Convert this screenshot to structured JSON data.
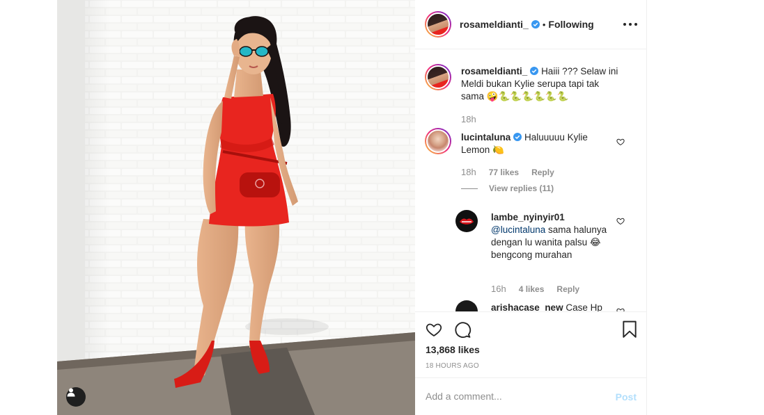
{
  "post": {
    "author": "rosameldianti_",
    "follow_status": "Following",
    "separator": "•",
    "caption": {
      "user": "rosameldianti_",
      "text": "Haiii ??? Selaw ini Meldi bukan Kylie serupa tapi tak sama 🤪🐍🐍🐍🐍🐍🐍",
      "time": "18h"
    },
    "comments": [
      {
        "user": "lucintaluna",
        "text": "Haluuuuu Kylie Lemon 🍋",
        "time": "18h",
        "likes": "77 likes",
        "reply_label": "Reply",
        "view_replies": "View replies (11)"
      },
      {
        "user": "lambe_nyinyir01",
        "mention": "@lucintaluna",
        "text": "sama halunya dengan lu wanita palsu 😂 bengcong murahan",
        "time": "16h",
        "likes": "4 likes",
        "reply_label": "Reply"
      },
      {
        "user": "arishacase_new",
        "text": "Case Hp"
      }
    ],
    "likes_count": "13,868 likes",
    "timestamp": "18 HOURS AGO",
    "add_comment_placeholder": "Add a comment...",
    "post_button": "Post"
  },
  "colors": {
    "verified": "#3897f0",
    "post_disabled": "#b2dffc",
    "dress": "#e8251f",
    "meta": "#8e8e8e"
  },
  "icons": {
    "more": "more-options-icon",
    "like": "heart-icon",
    "comment": "comment-bubble-icon",
    "save": "bookmark-icon",
    "tag": "user-tag-icon"
  }
}
